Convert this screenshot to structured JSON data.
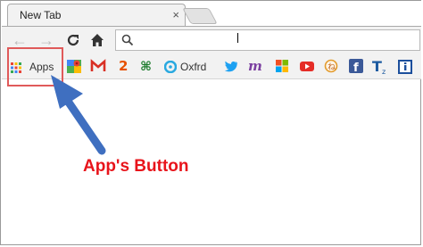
{
  "browser": {
    "tab": {
      "title": "New Tab",
      "close_glyph": "×"
    }
  },
  "toolbar": {
    "back_glyph": "←",
    "forward_glyph": "→",
    "reload_icon": "reload-icon",
    "home_icon": "home-icon",
    "search_icon": "search-icon"
  },
  "bookmarks": {
    "apps_label": "Apps",
    "oxford_label": "Oxfrd",
    "icons": [
      "apps-grid-icon",
      "maps-icon",
      "gmail-icon",
      "bookmark-2-icon",
      "cmd-icon",
      "oxford-icon",
      "twitter-icon",
      "m-icon",
      "windows-icon",
      "youtube-icon",
      "circle-icon",
      "facebook-icon",
      "tz-icon",
      "info-icon"
    ]
  },
  "annotation": {
    "caption": "App's Button",
    "highlight_color": "#e05a5a",
    "arrow_color": "#4a78c4",
    "caption_color": "#e8141b"
  }
}
